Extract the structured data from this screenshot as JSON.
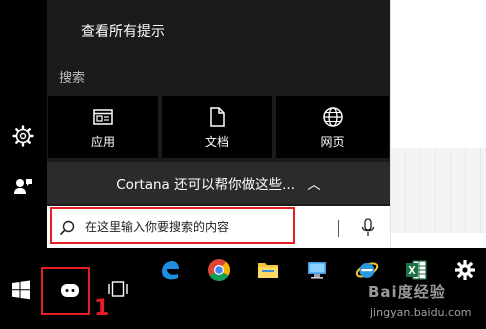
{
  "panel": {
    "tips_link": "查看所有提示",
    "search_section_label": "搜索",
    "categories": [
      {
        "label": "应用",
        "icon": "app-window-icon"
      },
      {
        "label": "文档",
        "icon": "document-icon"
      },
      {
        "label": "网页",
        "icon": "globe-icon"
      }
    ],
    "cortana_prompt": "Cortana 还可以帮你做这些...",
    "cortana_chevron": "︿",
    "search_placeholder": "在这里输入你要搜索的内容"
  },
  "left_rail": {
    "icons": [
      "settings-gear-icon",
      "account-feedback-icon"
    ]
  },
  "taskbar": {
    "items": [
      "windows-start-icon",
      "cortana-icon",
      "task-view-icon",
      "edge-icon",
      "chrome-icon",
      "file-explorer-icon",
      "this-pc-icon",
      "internet-explorer-icon",
      "excel-icon",
      "settings-gear-icon"
    ]
  },
  "annotations": {
    "step_number": "1",
    "highlight_color": "#e31e24"
  },
  "watermark": {
    "logo": "Bai度经验",
    "url": "jingyan.baidu.com"
  },
  "colors": {
    "panel_bg": "#1b1b1b",
    "tile_bg": "#000000",
    "cortana_bar_bg": "#2b2b2b",
    "taskbar_bg": "#000000"
  }
}
